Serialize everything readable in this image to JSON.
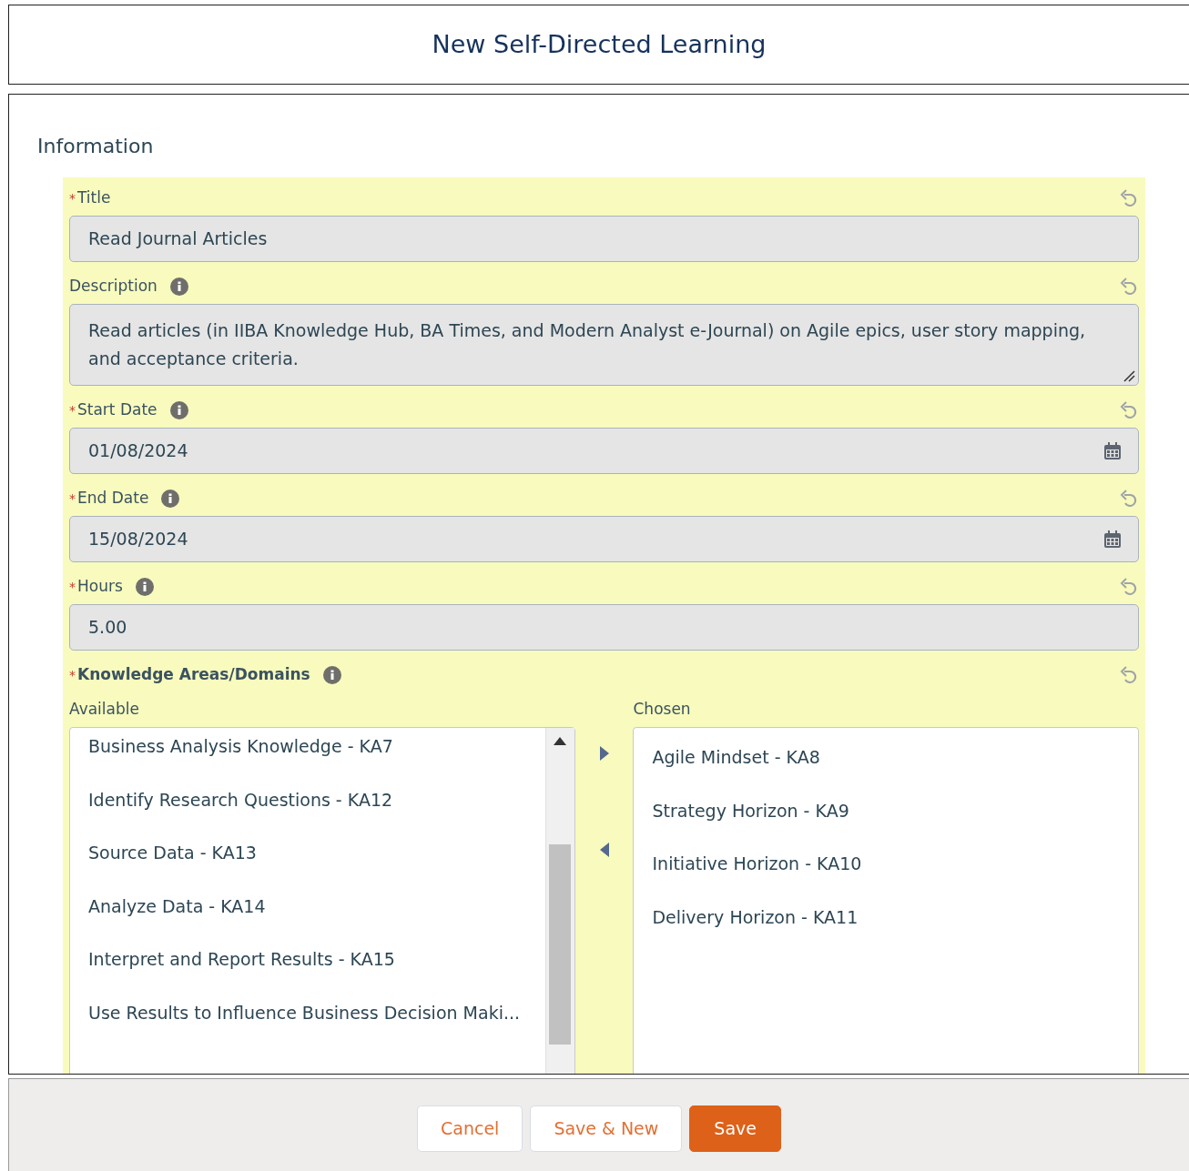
{
  "modal": {
    "title": "New Self-Directed Learning"
  },
  "section": {
    "title": "Information"
  },
  "fields": [
    {
      "kind": "text",
      "label": "Title",
      "required_mark": "*",
      "info": false,
      "value": "Read Journal Articles"
    },
    {
      "kind": "textarea",
      "label": "Description",
      "info": true,
      "value": "Read articles (in IIBA Knowledge Hub, BA Times, and Modern Analyst e-Journal) on Agile epics, user story mapping, and acceptance criteria."
    },
    {
      "kind": "date",
      "label": "Start Date",
      "required_mark": "*",
      "info": true,
      "value": "01/08/2024"
    },
    {
      "kind": "date",
      "label": "End Date",
      "required_mark": "*",
      "info": true,
      "value": "15/08/2024"
    },
    {
      "kind": "text",
      "label": "Hours",
      "required_mark": "*",
      "info": true,
      "value": "5.00"
    },
    {
      "kind": "dual_list",
      "label": "Knowledge Areas/Domains",
      "required_mark": "*",
      "info": true,
      "available_label": "Available",
      "chosen_label": "Chosen",
      "available": [
        "Business Analysis Knowledge - KA7",
        "Identify Research Questions - KA12",
        "Source Data - KA13",
        "Analyze Data - KA14",
        "Interpret and Report Results - KA15",
        "Use Results to Influence Business Decision Maki..."
      ],
      "chosen": [
        "Agile Mindset - KA8",
        "Strategy Horizon - KA9",
        "Initiative Horizon - KA10",
        "Delivery Horizon - KA11"
      ]
    }
  ],
  "buttons": [
    {
      "label": "Cancel",
      "kind": "neutral"
    },
    {
      "label": "Save & New",
      "kind": "neutral"
    },
    {
      "label": "Save",
      "kind": "brand"
    }
  ]
}
